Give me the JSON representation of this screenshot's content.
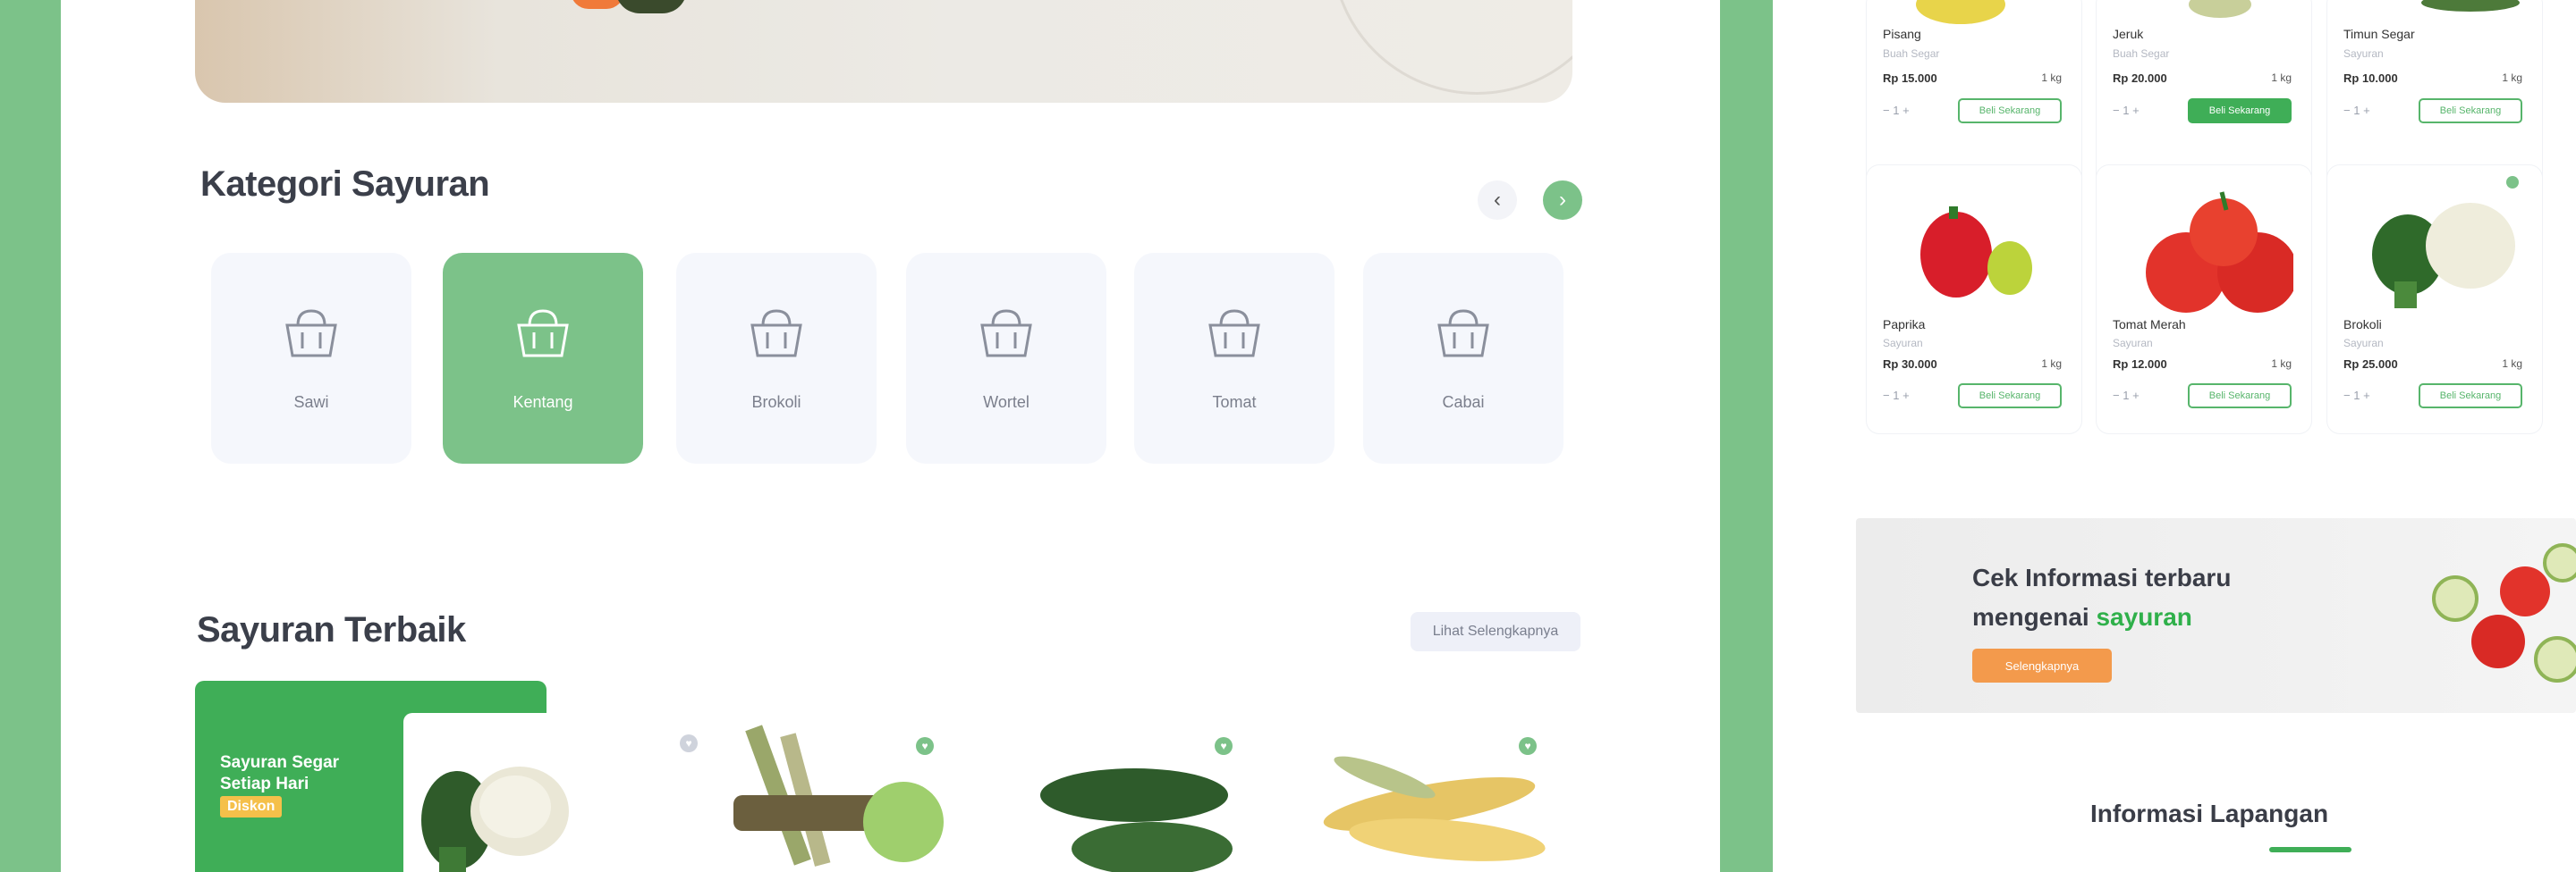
{
  "left": {
    "category_section": {
      "title": "Kategori Sayuran",
      "prev_icon": "chevron-left-icon",
      "next_icon": "chevron-right-icon",
      "categories": [
        {
          "label": "Sawi",
          "icon": "basket-icon",
          "active": false
        },
        {
          "label": "Kentang",
          "icon": "basket-icon",
          "active": true
        },
        {
          "label": "Brokoli",
          "icon": "basket-icon",
          "active": false
        },
        {
          "label": "Wortel",
          "icon": "basket-icon",
          "active": false
        },
        {
          "label": "Tomat",
          "icon": "basket-icon",
          "active": false
        },
        {
          "label": "Cabai",
          "icon": "basket-icon",
          "active": false
        }
      ]
    },
    "featured_section": {
      "title": "Sayuran Terbaik",
      "see_all_label": "Lihat Selengkapnya",
      "promo_text": "Sayuran Segar Setiap Hari",
      "promo_tag": "Diskon"
    }
  },
  "right": {
    "row1": [
      {
        "name": "Pisang",
        "sub": "Buah Segar",
        "price": "Rp 15.000",
        "unit": "1 kg",
        "qty": "1",
        "button": "Beli Sekarang",
        "button_filled": false
      },
      {
        "name": "Jeruk",
        "sub": "Buah Segar",
        "price": "Rp 20.000",
        "unit": "1 kg",
        "qty": "1",
        "button": "Beli Sekarang",
        "button_filled": true
      },
      {
        "name": "Timun Segar",
        "sub": "Sayuran",
        "price": "Rp 10.000",
        "unit": "1 kg",
        "qty": "1",
        "button": "Beli Sekarang",
        "button_filled": false
      }
    ],
    "row2": [
      {
        "name": "Paprika",
        "sub": "Sayuran",
        "price": "Rp 30.000",
        "unit": "1 kg",
        "qty": "1",
        "button": "Beli Sekarang",
        "button_filled": false
      },
      {
        "name": "Tomat Merah",
        "sub": "Sayuran",
        "price": "Rp 12.000",
        "unit": "1 kg",
        "qty": "1",
        "button": "Beli Sekarang",
        "button_filled": false
      },
      {
        "name": "Brokoli",
        "sub": "Sayuran",
        "price": "Rp 25.000",
        "unit": "1 kg",
        "qty": "1",
        "button": "Beli Sekarang",
        "button_filled": false
      }
    ],
    "banner": {
      "title_part1": "Cek Informasi terbaru",
      "title_part2": "mengenai",
      "title_accent": "sayuran",
      "button": "Selengkapnya"
    },
    "info_title": "Informasi Lapangan"
  },
  "colors": {
    "background_green": "#7cc289",
    "brand_green": "#3fae57",
    "accent_orange": "#f39a4c"
  }
}
